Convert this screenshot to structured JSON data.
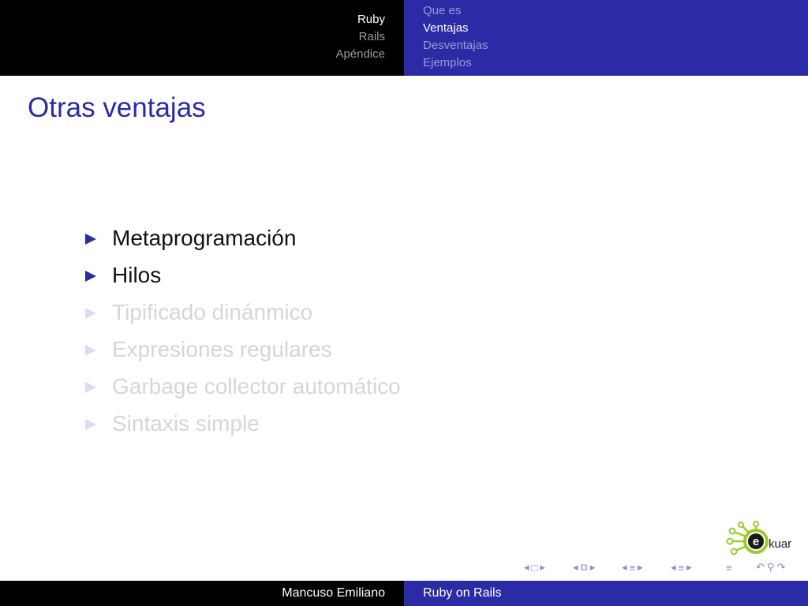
{
  "header": {
    "sections": [
      {
        "label": "Ruby",
        "active": true
      },
      {
        "label": "Rails",
        "active": false
      },
      {
        "label": "Apéndice",
        "active": false
      }
    ],
    "subsections": [
      {
        "label": "Que es",
        "active": false
      },
      {
        "label": "Ventajas",
        "active": true
      },
      {
        "label": "Desventajas",
        "active": false
      },
      {
        "label": "Ejemplos",
        "active": false
      }
    ]
  },
  "frame": {
    "title": "Otras ventajas",
    "items": [
      {
        "text": "Metaprogramación",
        "revealed": true
      },
      {
        "text": "Hilos",
        "revealed": true
      },
      {
        "text": "Tipificado dinánmico",
        "revealed": false
      },
      {
        "text": "Expresiones regulares",
        "revealed": false
      },
      {
        "text": "Garbage collector automático",
        "revealed": false
      },
      {
        "text": "Sintaxis simple",
        "revealed": false
      }
    ]
  },
  "logo": {
    "text": "kuar",
    "letter": "e"
  },
  "footer": {
    "author": "Mancuso Emiliano",
    "title": "Ruby on Rails"
  },
  "colors": {
    "accent": "#2b2ba6",
    "header_left_bg": "#000000",
    "dimmed_text": "#d6d6d6",
    "logo_green": "#9ccc2a"
  }
}
